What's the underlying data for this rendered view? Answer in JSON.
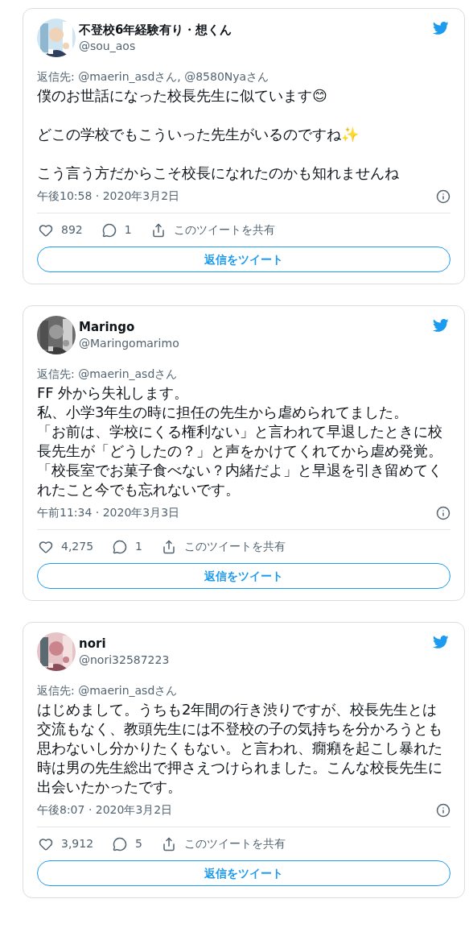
{
  "tweets": [
    {
      "name": "不登校6年経験有り・想くん",
      "handle": "@sou_aos",
      "avatar": {
        "kind": "picture"
      },
      "reply_to": "返信先: @maerin_asdさん, @8580Nyaさん",
      "paragraphs": [
        [
          "僕のお世話になった校長先生に似ています😊"
        ],
        [
          "どこの学校でもこういった先生がいるのですね✨"
        ],
        [
          "こう言う方だからこそ校長になれたのかも知れませんね"
        ]
      ],
      "timestamp": "午後10:58 · 2020年3月2日",
      "likes": "892",
      "replies": "1",
      "share": "このツイートを共有",
      "reply_button": "返信をツイート"
    },
    {
      "name": "Maringo",
      "handle": "@Maringomarimo",
      "avatar": {
        "kind": "picture"
      },
      "reply_to": "返信先: @maerin_asdさん",
      "paragraphs": [
        [
          "FF 外から失礼します。",
          "私、小学3年生の時に担任の先生から虐められてました。",
          "「お前は、学校にくる権利ない」と言われて早退したときに校長先生が「どうしたの？」と声をかけてくれてから虐め発覚。",
          "「校長室でお菓子食べない？内緒だよ」と早退を引き留めてくれたこと今でも忘れないです。"
        ]
      ],
      "timestamp": "午前11:34 · 2020年3月3日",
      "likes": "4,275",
      "replies": "1",
      "share": "このツイートを共有",
      "reply_button": "返信をツイート"
    },
    {
      "name": "nori",
      "handle": "@nori32587223",
      "avatar": {
        "kind": "picture"
      },
      "reply_to": "返信先: @maerin_asdさん",
      "paragraphs": [
        [
          "はじめまして。うちも2年間の行き渋りですが、校長先生とは交流もなく、教頭先生には不登校の子の気持ちを分かろうとも思わないし分かりたくもない。と言われ、癇癪を起こし暴れた時は男の先生総出で押さえつけられました。こんな校長先生に出会いたかったです。"
        ]
      ],
      "timestamp": "午後8:07 · 2020年3月2日",
      "likes": "3,912",
      "replies": "5",
      "share": "このツイートを共有",
      "reply_button": "返信をツイート"
    }
  ]
}
